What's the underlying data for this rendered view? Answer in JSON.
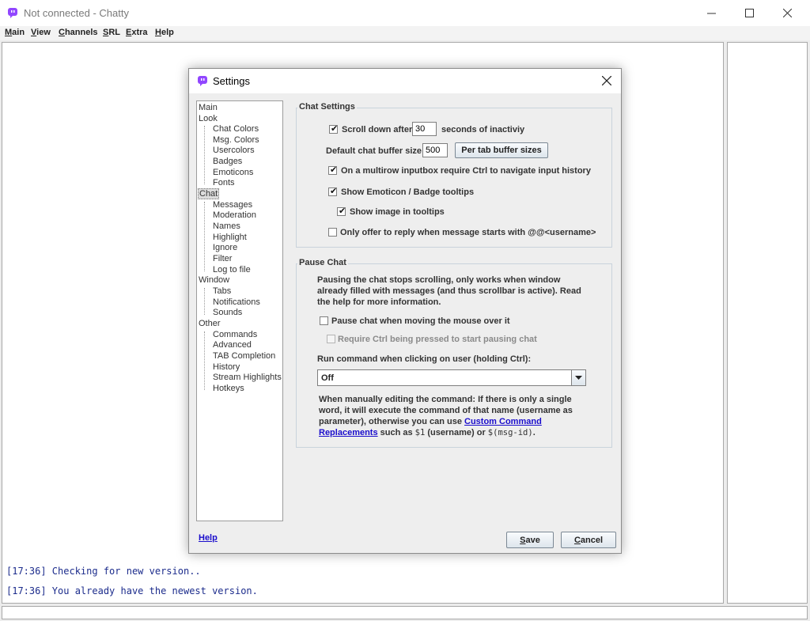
{
  "window": {
    "title": "Not connected - Chatty",
    "controls": {
      "minimize": "—",
      "maximize": "☐",
      "close": "✕"
    }
  },
  "menu": [
    {
      "label": "Main",
      "mnemonic": "M",
      "rest": "ain"
    },
    {
      "label": "View",
      "mnemonic": "V",
      "rest": "iew"
    },
    {
      "label": "Channels",
      "mnemonic": "C",
      "rest": "hannels"
    },
    {
      "label": "SRL",
      "mnemonic": "S",
      "rest": "RL"
    },
    {
      "label": "Extra",
      "mnemonic": "E",
      "rest": "xtra"
    },
    {
      "label": "Help",
      "mnemonic": "H",
      "rest": "elp"
    }
  ],
  "chat_log": [
    "[17:36] Checking for new version..",
    "[17:36] You already have the newest version."
  ],
  "dialog": {
    "title": "Settings",
    "tree": [
      "Main",
      "Look",
      "Chat Colors",
      "Msg. Colors",
      "Usercolors",
      "Badges",
      "Emoticons",
      "Fonts",
      "Chat",
      "Messages",
      "Moderation",
      "Names",
      "Highlight",
      "Ignore",
      "Filter",
      "Log to file",
      "Window",
      "Tabs",
      "Notifications",
      "Sounds",
      "Other",
      "Commands",
      "Advanced",
      "TAB Completion",
      "History",
      "Stream Highlights",
      "Hotkeys"
    ],
    "selected_tree_item": "Chat",
    "chat_settings": {
      "title": "Chat Settings",
      "scroll_label": "Scroll down after",
      "scroll_value": "30",
      "scroll_suffix": "seconds of inactiviy",
      "buffer_label": "Default chat buffer size:",
      "buffer_value": "500",
      "per_tab_button": "Per tab buffer sizes",
      "multirow_label": "On a multirow inputbox require Ctrl to navigate input history",
      "tooltips_label": "Show Emoticon / Badge tooltips",
      "image_tooltips_label": "Show image in tooltips",
      "reply_label": "Only offer to reply when message starts with @@<username>"
    },
    "pause_chat": {
      "title": "Pause Chat",
      "description": "Pausing the chat stops scrolling, only works when window already filled with messages (and thus scrollbar is active). Read the help for more information.",
      "pause_mouse_label": "Pause chat when moving the mouse over it",
      "require_ctrl_label": "Require Ctrl being pressed to start pausing chat",
      "run_command_label": "Run command when clicking on user (holding Ctrl):",
      "command_value": "Off",
      "note_part1": "When manually editing the command: If there is only a single word, it will execute the command of that name (username as parameter), otherwise you can use ",
      "note_link": "Custom Command Replacements",
      "note_part2": " such as ",
      "note_code1": "$1",
      "note_part3": " (username) or ",
      "note_code2": "$(msg-id)",
      "note_part4": "."
    },
    "help_link": "Help",
    "save_button": {
      "mnemonic": "S",
      "rest": "ave",
      "label": "Save"
    },
    "cancel_button": {
      "mnemonic": "C",
      "rest": "ancel",
      "label": "Cancel"
    }
  },
  "colors": {
    "chat_text": "#1c2c8c",
    "link": "#1a0dcc",
    "app_icon": "#9146ff"
  }
}
